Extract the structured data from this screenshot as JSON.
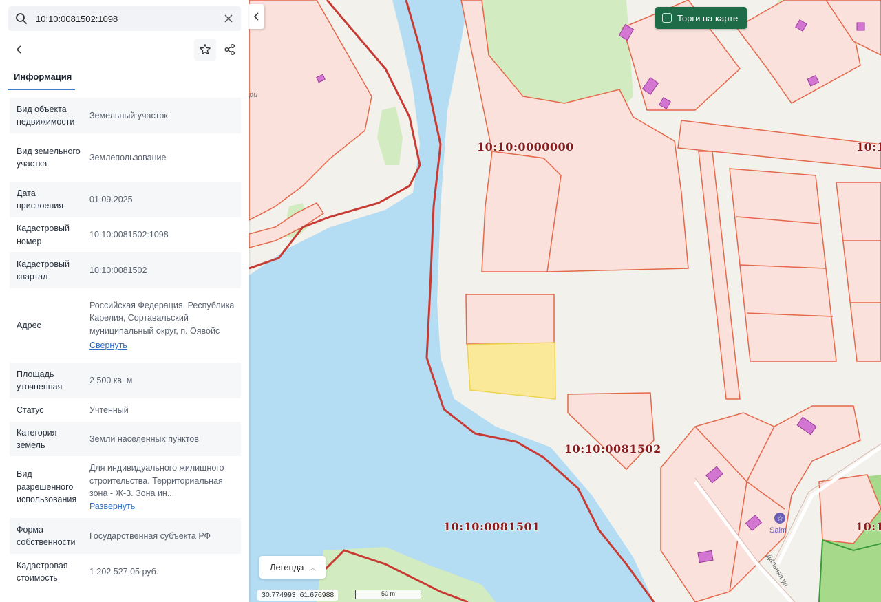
{
  "search": {
    "value": "10:10:0081502:1098"
  },
  "tabs": {
    "info": "Информация"
  },
  "info": [
    {
      "key": "Вид объекта недвижимости",
      "value": "Земельный участок"
    },
    {
      "key": "Вид земельного участка",
      "value": "Землепользование"
    },
    {
      "key": "Дата присвоения",
      "value": "01.09.2025"
    },
    {
      "key": "Кадастровый номер",
      "value": "10:10:0081502:1098"
    },
    {
      "key": "Кадастровый квартал",
      "value": "10:10:0081502"
    },
    {
      "key": "Адрес",
      "value": "Российская Федерация, Республика Карелия, Сортавальский муниципальный округ, п. Оявойс",
      "link": "Свернуть"
    },
    {
      "key": "Площадь уточненная",
      "value": "2 500 кв. м"
    },
    {
      "key": "Статус",
      "value": "Учтенный"
    },
    {
      "key": "Категория земель",
      "value": "Земли населенных пунктов"
    },
    {
      "key": "Вид разрешенного использования",
      "value": "Для индивидуального жилищного строительства. Территориальная зона - Ж-3. Зона ин...",
      "link": "Развернуть"
    },
    {
      "key": "Форма собственности",
      "value": "Государственная субъекта РФ"
    },
    {
      "key": "Кадастровая стоимость",
      "value": "1 202 527,05 руб."
    }
  ],
  "map": {
    "torgi_label": "Торги на карте",
    "legend_label": "Легенда",
    "coords": {
      "lon": "30.774993",
      "lat": "61.676988"
    },
    "scale_label": "50 m",
    "labels": {
      "q0000000": "10:10:0000000",
      "q0081502": "10:10:0081502",
      "q0081501": "10:10:0081501",
      "edge_top": "10:1",
      "edge_bottom": "10:1"
    },
    "text_fragments": {
      "left_edge": "ри",
      "poi": "Salm",
      "street": "Дальняя ул."
    }
  },
  "colors": {
    "water": "#b4dcf3",
    "parcel_fill": "#fbe1dc",
    "parcel_stroke": "#e4684a",
    "selected_fill": "#fbe99a",
    "forest": "#d9ecc8",
    "building": "#d276d2",
    "boundary": "#c63b33",
    "accent": "#1d6b47"
  }
}
